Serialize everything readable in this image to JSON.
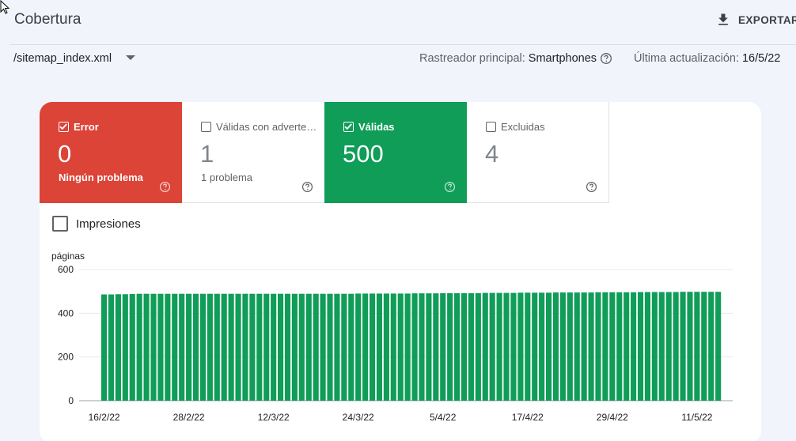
{
  "header": {
    "title": "Cobertura",
    "export_label": "EXPORTAR"
  },
  "filters": {
    "sitemap": "/sitemap_index.xml",
    "crawler_label": "Rastreador principal:",
    "crawler_value": "Smartphones",
    "updated_label": "Última actualización:",
    "updated_value": "16/5/22"
  },
  "tiles": [
    {
      "label": "Error",
      "value": "0",
      "sub": "Ningún problema",
      "checked": true,
      "color": "#db4437"
    },
    {
      "label": "Válidas con advertencias",
      "value": "1",
      "sub": "1 problema",
      "checked": false,
      "color": "#ffffff"
    },
    {
      "label": "Válidas",
      "value": "500",
      "sub": "",
      "checked": true,
      "color": "#0f9d58"
    },
    {
      "label": "Excluidas",
      "value": "4",
      "sub": "",
      "checked": false,
      "color": "#ffffff"
    }
  ],
  "impressions_label": "Impresiones",
  "colors": {
    "error": "#db4437",
    "valid": "#0f9d58",
    "page_bg": "#f1f4fb"
  },
  "icons": {
    "export": "download-icon",
    "dropdown": "arrow-drop-down-icon",
    "help": "help-circle-icon",
    "checkbox": "check-icon"
  },
  "chart_data": {
    "type": "bar",
    "ylabel": "páginas",
    "ylim": [
      0,
      600
    ],
    "yticks": [
      0,
      200,
      400,
      600
    ],
    "x_tick_labels": [
      "16/2/22",
      "28/2/22",
      "12/3/22",
      "24/3/22",
      "5/4/22",
      "17/4/22",
      "29/4/22",
      "11/5/22"
    ],
    "x_tick_indices": [
      0,
      12,
      24,
      36,
      48,
      60,
      72,
      84
    ],
    "series": [
      {
        "color": "#0f9d58",
        "values": [
          486,
          486,
          487,
          487,
          488,
          489,
          489,
          489,
          489,
          489,
          489,
          489,
          489,
          489,
          489,
          489,
          489,
          489,
          489,
          489,
          489,
          489,
          489,
          489,
          489,
          489,
          489,
          489,
          489,
          489,
          489,
          489,
          489,
          489,
          489,
          489,
          490,
          490,
          490,
          490,
          490,
          490,
          490,
          490,
          491,
          491,
          491,
          491,
          492,
          492,
          492,
          492,
          492,
          492,
          493,
          493,
          493,
          493,
          493,
          494,
          494,
          494,
          494,
          494,
          495,
          495,
          495,
          495,
          495,
          495,
          496,
          496,
          496,
          496,
          496,
          496,
          497,
          497,
          497,
          497,
          497,
          497,
          498,
          498,
          498,
          498,
          498,
          498
        ]
      }
    ]
  }
}
